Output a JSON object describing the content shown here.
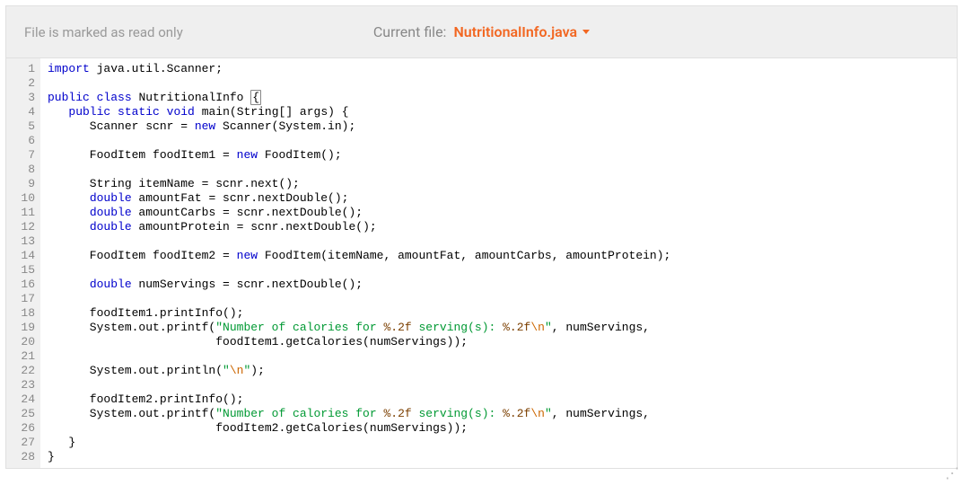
{
  "toolbar": {
    "readonly_msg": "File is marked as read only",
    "current_file_label": "Current file:",
    "current_file_name": "NutritionalInfo.java"
  },
  "gutter": {
    "start": 1,
    "end": 28
  },
  "code_lines": [
    [
      [
        "kw",
        "import"
      ],
      [
        "",
        " java.util.Scanner;"
      ]
    ],
    [],
    [
      [
        "kw",
        "public"
      ],
      [
        "",
        " "
      ],
      [
        "kw",
        "class"
      ],
      [
        "",
        " "
      ],
      [
        "cls",
        "NutritionalInfo"
      ],
      [
        "",
        " "
      ],
      [
        "box",
        "{"
      ]
    ],
    [
      [
        "",
        "   "
      ],
      [
        "kw",
        "public"
      ],
      [
        "",
        " "
      ],
      [
        "kw",
        "static"
      ],
      [
        "",
        " "
      ],
      [
        "kw",
        "void"
      ],
      [
        "",
        " "
      ],
      [
        "meth",
        "main"
      ],
      [
        "",
        "(String[] args) {"
      ]
    ],
    [
      [
        "",
        "      Scanner scnr = "
      ],
      [
        "kw",
        "new"
      ],
      [
        "",
        " Scanner(System.in);"
      ]
    ],
    [],
    [
      [
        "",
        "      FoodItem foodItem1 = "
      ],
      [
        "kw",
        "new"
      ],
      [
        "",
        " FoodItem();"
      ]
    ],
    [],
    [
      [
        "",
        "      String itemName = scnr.next();"
      ]
    ],
    [
      [
        "",
        "      "
      ],
      [
        "kw",
        "double"
      ],
      [
        "",
        " amountFat = scnr.nextDouble();"
      ]
    ],
    [
      [
        "",
        "      "
      ],
      [
        "kw",
        "double"
      ],
      [
        "",
        " amountCarbs = scnr.nextDouble();"
      ]
    ],
    [
      [
        "",
        "      "
      ],
      [
        "kw",
        "double"
      ],
      [
        "",
        " amountProtein = scnr.nextDouble();"
      ]
    ],
    [],
    [
      [
        "",
        "      FoodItem foodItem2 = "
      ],
      [
        "kw",
        "new"
      ],
      [
        "",
        " FoodItem(itemName, amountFat, amountCarbs, amountProtein);"
      ]
    ],
    [],
    [
      [
        "",
        "      "
      ],
      [
        "kw",
        "double"
      ],
      [
        "",
        " numServings = scnr.nextDouble();"
      ]
    ],
    [],
    [
      [
        "",
        "      foodItem1.printInfo();"
      ]
    ],
    [
      [
        "",
        "      System.out.printf("
      ],
      [
        "str",
        "\"Number of calories for "
      ],
      [
        "fmt",
        "%.2f"
      ],
      [
        "str",
        " serving(s): "
      ],
      [
        "fmt",
        "%.2f"
      ],
      [
        "esc",
        "\\n"
      ],
      [
        "str",
        "\""
      ],
      [
        "",
        ", numServings,"
      ]
    ],
    [
      [
        "",
        "                        foodItem1.getCalories(numServings));"
      ]
    ],
    [],
    [
      [
        "",
        "      System.out.println("
      ],
      [
        "str",
        "\""
      ],
      [
        "esc",
        "\\n"
      ],
      [
        "str",
        "\""
      ],
      [
        "",
        ");"
      ]
    ],
    [],
    [
      [
        "",
        "      foodItem2.printInfo();"
      ]
    ],
    [
      [
        "",
        "      System.out.printf("
      ],
      [
        "str",
        "\"Number of calories for "
      ],
      [
        "fmt",
        "%.2f"
      ],
      [
        "str",
        " serving(s): "
      ],
      [
        "fmt",
        "%.2f"
      ],
      [
        "esc",
        "\\n"
      ],
      [
        "str",
        "\""
      ],
      [
        "",
        ", numServings,"
      ]
    ],
    [
      [
        "",
        "                        foodItem2.getCalories(numServings));"
      ]
    ],
    [
      [
        "",
        "   }"
      ]
    ],
    [
      [
        "",
        "}"
      ]
    ]
  ]
}
